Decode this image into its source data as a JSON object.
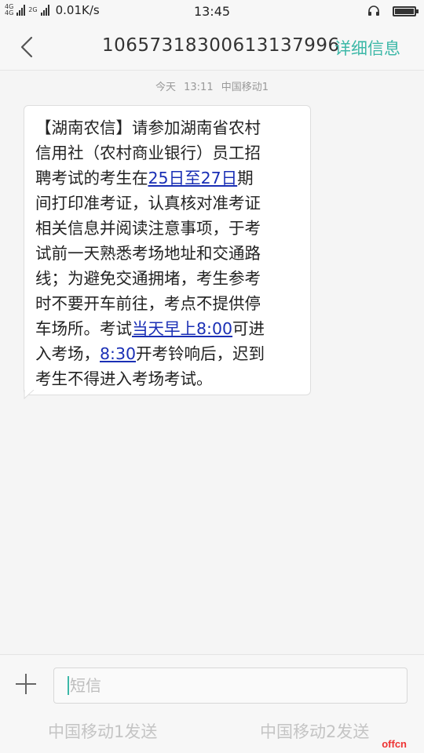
{
  "status_bar": {
    "network_1": "4G",
    "network_2": "4G",
    "network_3": "2G",
    "speed": "0.01K/s",
    "time": "13:45",
    "icons": [
      "signal-icon",
      "signal-icon",
      "headset-icon",
      "battery-icon"
    ],
    "battery_level": 1.0
  },
  "header": {
    "back_icon": "chevron-left-icon",
    "number": "10657318300613137996",
    "detail_label": "详细信息"
  },
  "thread": {
    "day": "今天",
    "time": "13:11",
    "carrier": "中国移动1"
  },
  "message": {
    "part1": "【湖南农信】请参加湖南省农村\n信用社（农村商业银行）员工招\n聘考试的考生在",
    "link1": "25日至27日",
    "part2": "期\n间打印准考证，认真核对准考证\n相关信息并阅读注意事项，于考\n试前一天熟悉考场地址和交通路\n线；为避免交通拥堵，考生参考\n时不要开车前往，考点不提供停\n车场所。考试",
    "link2": "当天早上8:00",
    "part3": "可进\n入考场，",
    "link3": "8:30",
    "part4": "开考铃响后，迟到\n考生不得进入考场考试。",
    "link_color": "#1a2fb5"
  },
  "composer": {
    "add_icon": "plus-icon",
    "placeholder": "短信",
    "send1_label": "中国移动1发送",
    "send2_label": "中国移动2发送"
  },
  "watermark": "offcn",
  "colors": {
    "accent": "#3db8a8",
    "background": "#f5f5f5"
  }
}
